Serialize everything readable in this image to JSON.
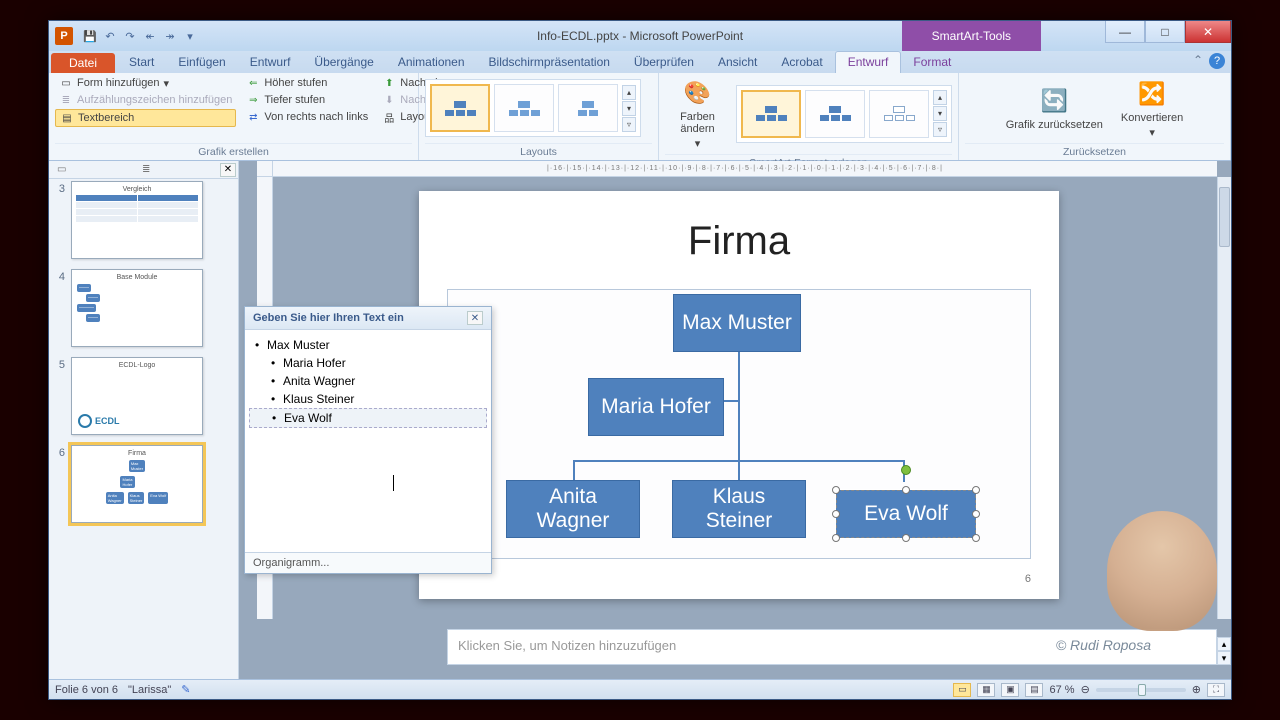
{
  "window": {
    "title_file": "Info-ECDL.pptx",
    "title_app": "Microsoft PowerPoint",
    "context_tool": "SmartArt-Tools"
  },
  "tabs": {
    "file": "Datei",
    "start": "Start",
    "einfuegen": "Einfügen",
    "entwurf": "Entwurf",
    "uebergaenge": "Übergänge",
    "animationen": "Animationen",
    "bildschirm": "Bildschirmpräsentation",
    "ueberpruefen": "Überprüfen",
    "ansicht": "Ansicht",
    "acrobat": "Acrobat",
    "sa_entwurf": "Entwurf",
    "sa_format": "Format"
  },
  "ribbon": {
    "form_hinzu": "Form hinzufügen",
    "aufzaehlung": "Aufzählungszeichen hinzufügen",
    "textbereich": "Textbereich",
    "hoeher": "Höher stufen",
    "tiefer": "Tiefer stufen",
    "vrnl": "Von rechts nach links",
    "nach_oben": "Nach oben",
    "nach_unten": "Nach unten",
    "layout": "Layout",
    "grp_grafik": "Grafik erstellen",
    "grp_layouts": "Layouts",
    "farben": "Farben ändern",
    "grp_formatv": "SmartArt-Formatvorlagen",
    "grafik_reset": "Grafik zurücksetzen",
    "konvertieren": "Konvertieren",
    "grp_reset": "Zurücksetzen"
  },
  "thumbs": [
    {
      "num": "3",
      "title": "Vergleich"
    },
    {
      "num": "4",
      "title": "Base Module"
    },
    {
      "num": "5",
      "title": "ECDL-Logo",
      "logo": "ECDL"
    },
    {
      "num": "6",
      "title": "Firma",
      "selected": true
    }
  ],
  "text_pane": {
    "header": "Geben Sie hier Ihren Text ein",
    "items": [
      {
        "text": "Max Muster",
        "lvl": 0
      },
      {
        "text": "Maria  Hofer",
        "lvl": 1
      },
      {
        "text": "Anita Wagner",
        "lvl": 1
      },
      {
        "text": "Klaus Steiner",
        "lvl": 1
      },
      {
        "text": "Eva Wolf",
        "lvl": 1,
        "selected": true
      }
    ],
    "footer": "Organigramm..."
  },
  "slide": {
    "title": "Firma",
    "page_num": "6",
    "nodes": {
      "root": "Max Muster",
      "assist": "Maria Hofer",
      "c1": "Anita Wagner",
      "c2": "Klaus Steiner",
      "c3": "Eva Wolf"
    }
  },
  "notes_placeholder": "Klicken Sie, um Notizen hinzuzufügen",
  "credit": "© Rudi Roposa",
  "status": {
    "slide_of": "Folie 6 von 6",
    "theme": "\"Larissa\"",
    "zoom": "67 %"
  },
  "ruler_h": "|·16·|·15·|·14·|·13·|·12·|·11·|·10·|·9·|·8·|·7·|·6·|·5·|·4·|·3·|·2·|·1·|·0·|·1·|·2·|·3·|·4·|·5·|·6·|·7·|·8·|"
}
